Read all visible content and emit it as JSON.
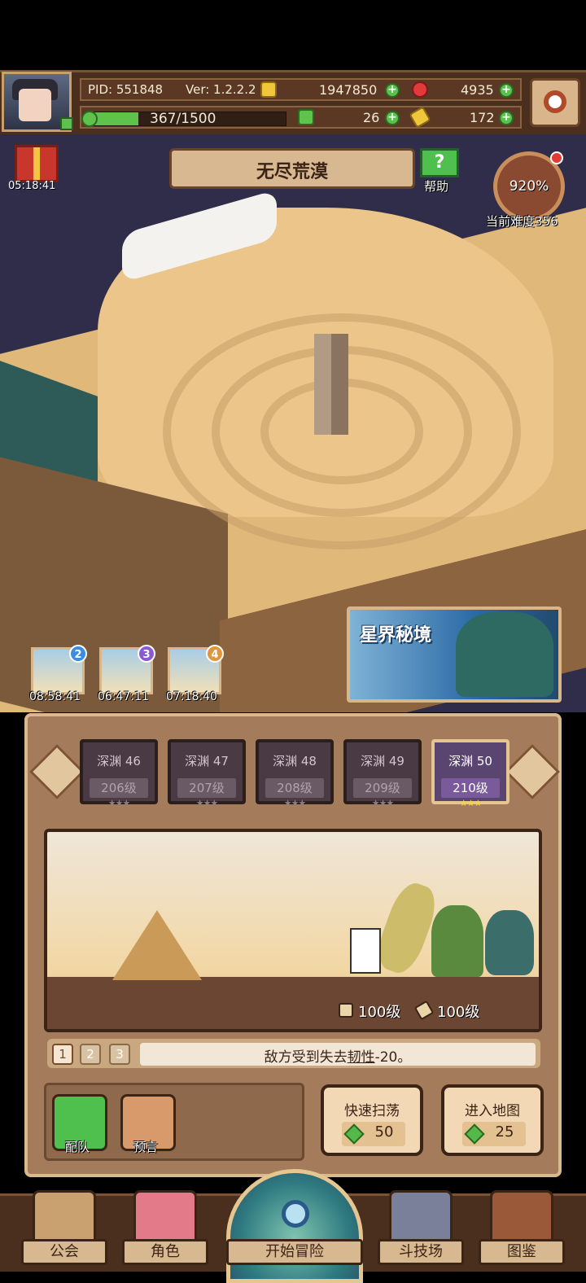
{
  "header": {
    "pid": "PID: 551848",
    "version": "Ver: 1.2.2.2",
    "gold": "1947850",
    "ruby": "4935",
    "stamina": "367/1500",
    "stamina_fraction": 0.245,
    "clover": "26",
    "key": "172"
  },
  "gift": {
    "timer": "05:18:41"
  },
  "map": {
    "title": "无尽荒漠",
    "help_label": "帮助",
    "difficulty_percent": "920%",
    "difficulty_label": "当前难度356"
  },
  "slots": [
    {
      "num": "2",
      "time": "08:58:41",
      "color": "#3a8de0"
    },
    {
      "num": "3",
      "time": "06:47:11",
      "color": "#8a5ad0"
    },
    {
      "num": "4",
      "time": "07:18:40",
      "color": "#e0963a"
    }
  ],
  "astral": {
    "title": "星界秘境"
  },
  "stages": [
    {
      "name": "深渊 46",
      "level": "206级",
      "stars": "★★★",
      "selected": false
    },
    {
      "name": "深渊 47",
      "level": "207级",
      "stars": "★★★",
      "selected": false
    },
    {
      "name": "深渊 48",
      "level": "208级",
      "stars": "★★★",
      "selected": false
    },
    {
      "name": "深渊 49",
      "level": "209级",
      "stars": "★★★",
      "selected": false
    },
    {
      "name": "深渊 50",
      "level": "210级",
      "stars": "★★★",
      "selected": true
    }
  ],
  "scene": {
    "player_level": "100级",
    "pet_level": "100级"
  },
  "tips": {
    "tabs": [
      "1",
      "2",
      "3"
    ],
    "active_tab": "1",
    "text_prefix": "敌方受到失去",
    "text_highlight": "韧性",
    "text_suffix": "-20。"
  },
  "actions": {
    "team_label": "配队",
    "prophecy_label": "预言",
    "sweep_label": "快速扫荡",
    "sweep_cost": "50",
    "enter_label": "进入地图",
    "enter_cost": "25"
  },
  "nav": {
    "guild": "公会",
    "character": "角色",
    "start": "开始冒险",
    "arena": "斗技场",
    "codex": "图鉴"
  },
  "colors": {
    "accent_green": "#5fc24b",
    "panel_brown": "#a47c5b",
    "selected_stage": "#5a4470"
  }
}
